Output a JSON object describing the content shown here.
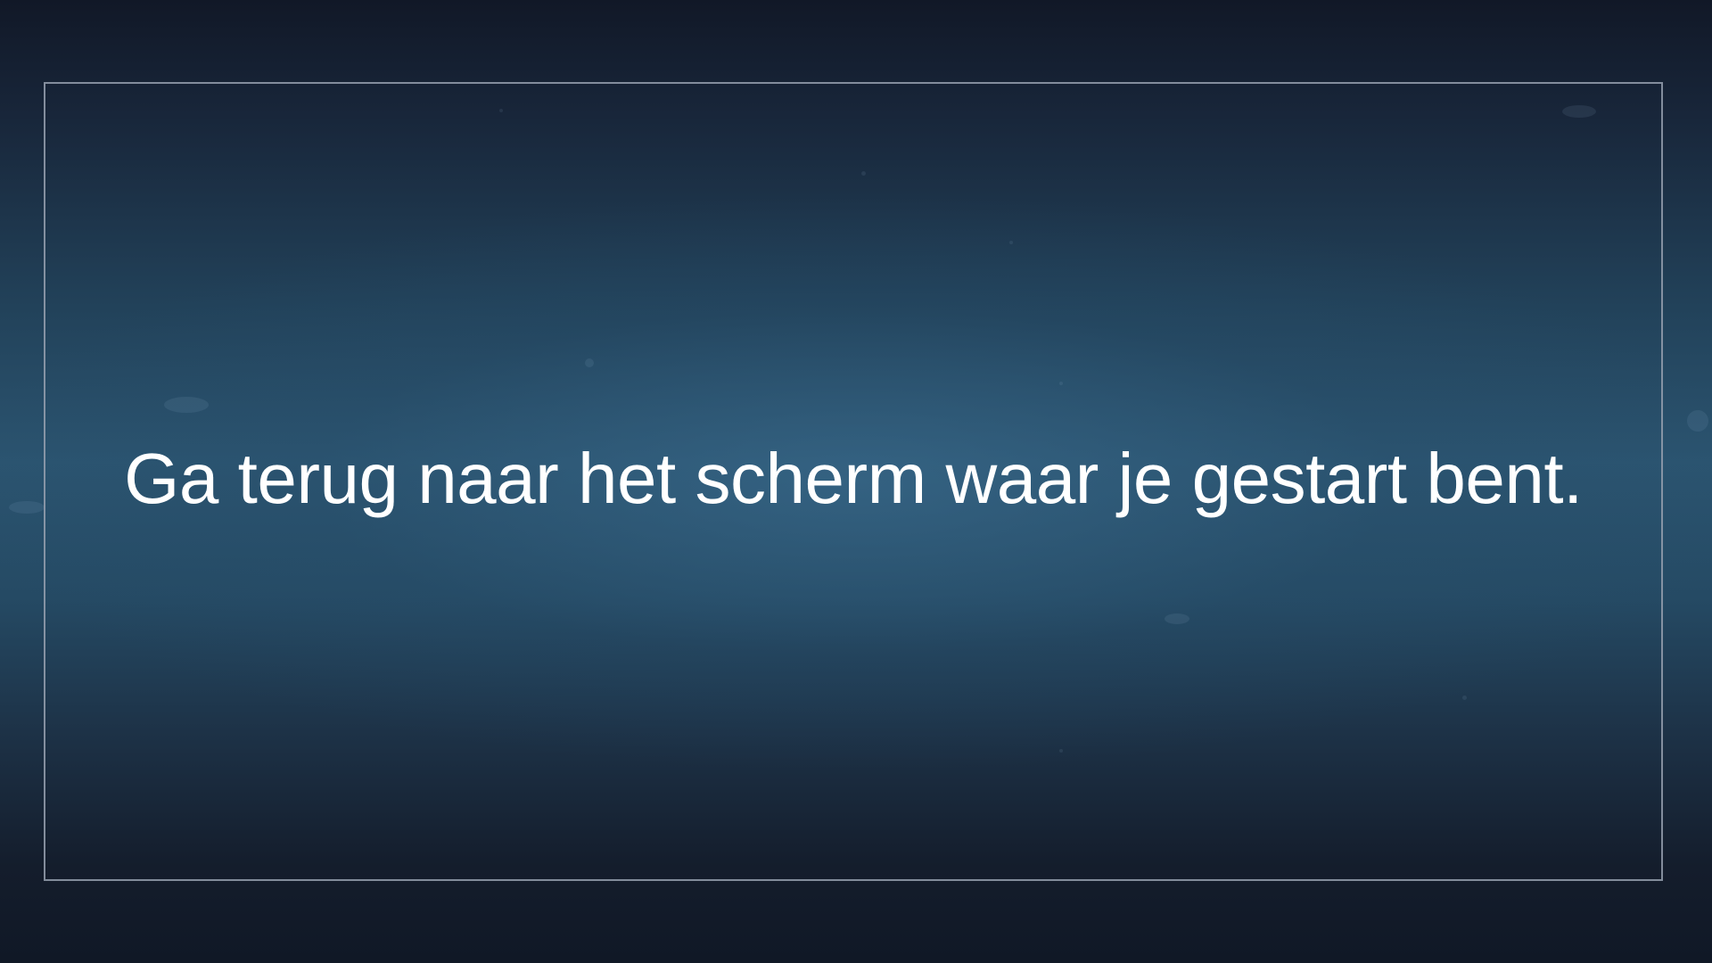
{
  "screen": {
    "message": "Ga terug naar het scherm waar je gestart bent."
  },
  "colors": {
    "text": "#ffffff",
    "frame_border": "#969fae",
    "background_top": "#111827",
    "background_center": "#2b5470",
    "background_bottom": "#101826"
  }
}
